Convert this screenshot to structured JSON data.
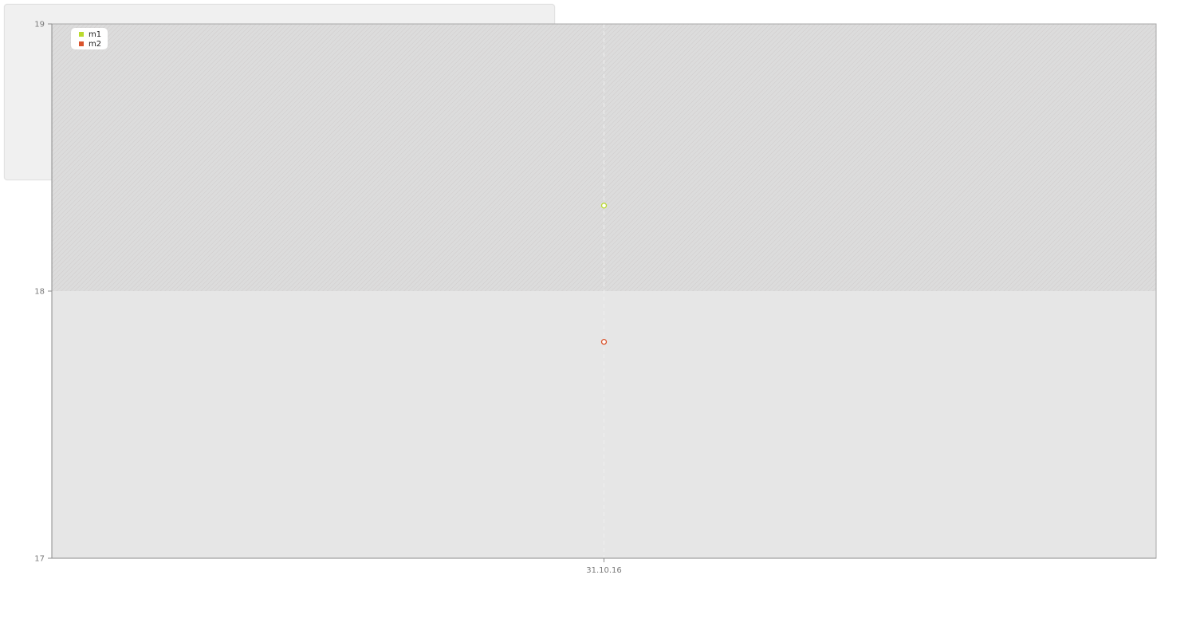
{
  "chart_data": {
    "type": "scatter",
    "title": "",
    "xlabel": "",
    "ylabel": "",
    "x_categories": [
      "31.10.16"
    ],
    "ylim": [
      17,
      19
    ],
    "yticks": [
      "17",
      "18",
      "19"
    ],
    "grid": false,
    "legend_position": "top-left",
    "band": {
      "from": 18,
      "to": 19,
      "color": "#dcdcdc"
    },
    "plot_background": "#e6e6e6",
    "series": [
      {
        "name": "m1",
        "color": "#bada2e",
        "points": [
          {
            "x": "31.10.16",
            "y": 18.32
          }
        ]
      },
      {
        "name": "m2",
        "color": "#d9532c",
        "points": [
          {
            "x": "31.10.16",
            "y": 17.81
          }
        ]
      }
    ]
  }
}
